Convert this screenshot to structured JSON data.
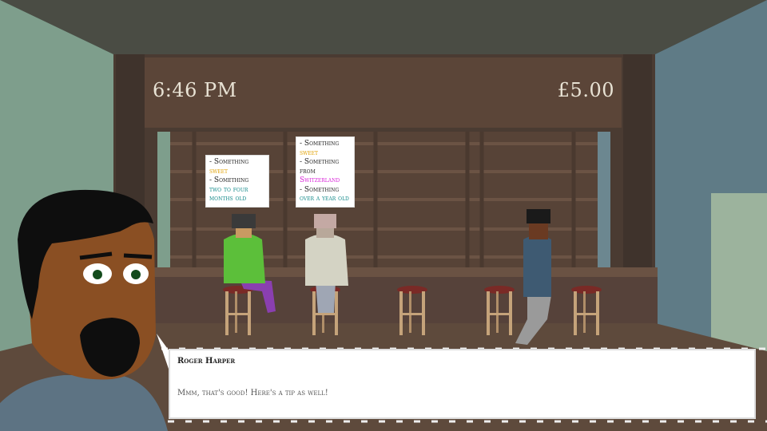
{
  "hud": {
    "time": "6:46 PM",
    "money": "£5.00"
  },
  "customers": [
    {
      "request_lines": [
        {
          "prefix": "- Something",
          "value": "sweet",
          "color": "#e0a000"
        },
        {
          "prefix": "- Something",
          "value": "two to four months old",
          "color": "#138a8a"
        }
      ]
    },
    {
      "request_lines": [
        {
          "prefix": "- Something",
          "value": "sweet",
          "color": "#e0a000"
        },
        {
          "prefix": "- Something from",
          "value": "Switzerland",
          "color": "#d81fd8"
        },
        {
          "prefix": "- Something",
          "value": "over a year old",
          "color": "#138a8a"
        }
      ]
    }
  ],
  "dialogue": {
    "speaker": "Roger Harper",
    "text": "Mmm, that's good! Here's a tip as well!"
  }
}
